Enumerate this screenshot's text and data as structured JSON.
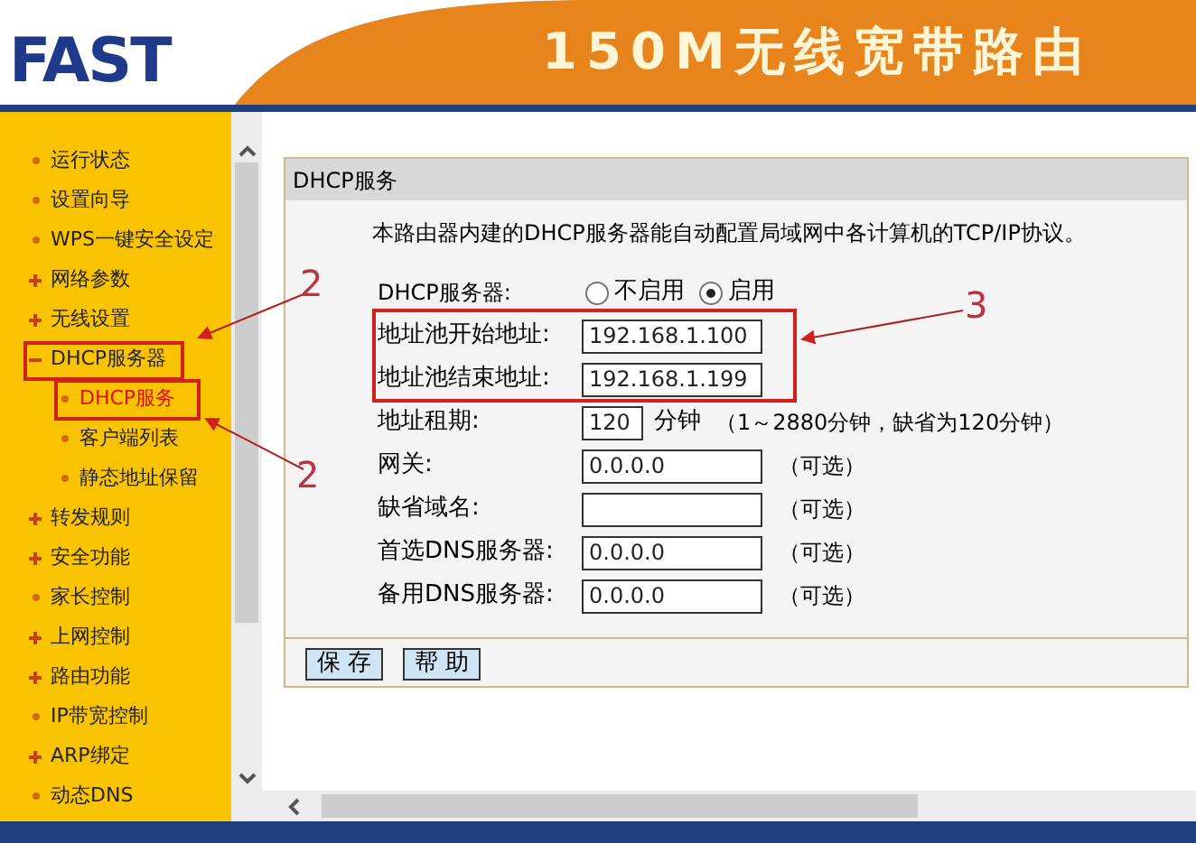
{
  "header": {
    "logo": "FAST",
    "title": "150M无线宽带路由"
  },
  "sidebar": {
    "items": [
      {
        "label": "运行状态",
        "kind": "leaf",
        "selected": false
      },
      {
        "label": "设置向导",
        "kind": "leaf",
        "selected": false
      },
      {
        "label": "WPS一键安全设定",
        "kind": "leaf",
        "selected": false
      },
      {
        "label": "网络参数",
        "kind": "group",
        "expanded": false,
        "selected": false
      },
      {
        "label": "无线设置",
        "kind": "group",
        "expanded": false,
        "selected": false
      },
      {
        "label": "DHCP服务器",
        "kind": "group",
        "expanded": true,
        "selected": false,
        "children": [
          {
            "label": "DHCP服务",
            "kind": "leaf",
            "selected": true
          },
          {
            "label": "客户端列表",
            "kind": "leaf",
            "selected": false
          },
          {
            "label": "静态地址保留",
            "kind": "leaf",
            "selected": false
          }
        ]
      },
      {
        "label": "转发规则",
        "kind": "group",
        "expanded": false,
        "selected": false
      },
      {
        "label": "安全功能",
        "kind": "group",
        "expanded": false,
        "selected": false
      },
      {
        "label": "家长控制",
        "kind": "leaf",
        "selected": false
      },
      {
        "label": "上网控制",
        "kind": "group",
        "expanded": false,
        "selected": false
      },
      {
        "label": "路由功能",
        "kind": "group",
        "expanded": false,
        "selected": false
      },
      {
        "label": "IP带宽控制",
        "kind": "leaf",
        "selected": false
      },
      {
        "label": "ARP绑定",
        "kind": "group",
        "expanded": false,
        "selected": false
      },
      {
        "label": "动态DNS",
        "kind": "leaf",
        "selected": false
      }
    ]
  },
  "panel": {
    "title": "DHCP服务",
    "description": "本路由器内建的DHCP服务器能自动配置局域网中各计算机的TCP/IP协议。",
    "server": {
      "label": "DHCP服务器:",
      "options": [
        {
          "label": "不启用",
          "selected": false
        },
        {
          "label": "启用",
          "selected": true
        }
      ]
    },
    "fields": [
      {
        "label": "地址池开始地址:",
        "value": "192.168.1.100",
        "kind": "wide"
      },
      {
        "label": "地址池结束地址:",
        "value": "192.168.1.199",
        "kind": "wide"
      },
      {
        "label": "地址租期:",
        "value": "120",
        "kind": "short",
        "unit": "分钟",
        "note": "（1～2880分钟，缺省为120分钟）"
      },
      {
        "label": "网关:",
        "value": "0.0.0.0",
        "kind": "wide",
        "note": "（可选）"
      },
      {
        "label": "缺省域名:",
        "kind": "wide",
        "note": "（可选）"
      },
      {
        "label": "首选DNS服务器:",
        "value": "0.0.0.0",
        "kind": "wide",
        "note": "（可选）"
      },
      {
        "label": "备用DNS服务器:",
        "value": "0.0.0.0",
        "kind": "wide",
        "note": "（可选）"
      }
    ],
    "buttons": [
      "保 存",
      "帮 助"
    ]
  },
  "annotations": [
    {
      "label": "2"
    },
    {
      "label": "2"
    },
    {
      "label": "3"
    }
  ]
}
